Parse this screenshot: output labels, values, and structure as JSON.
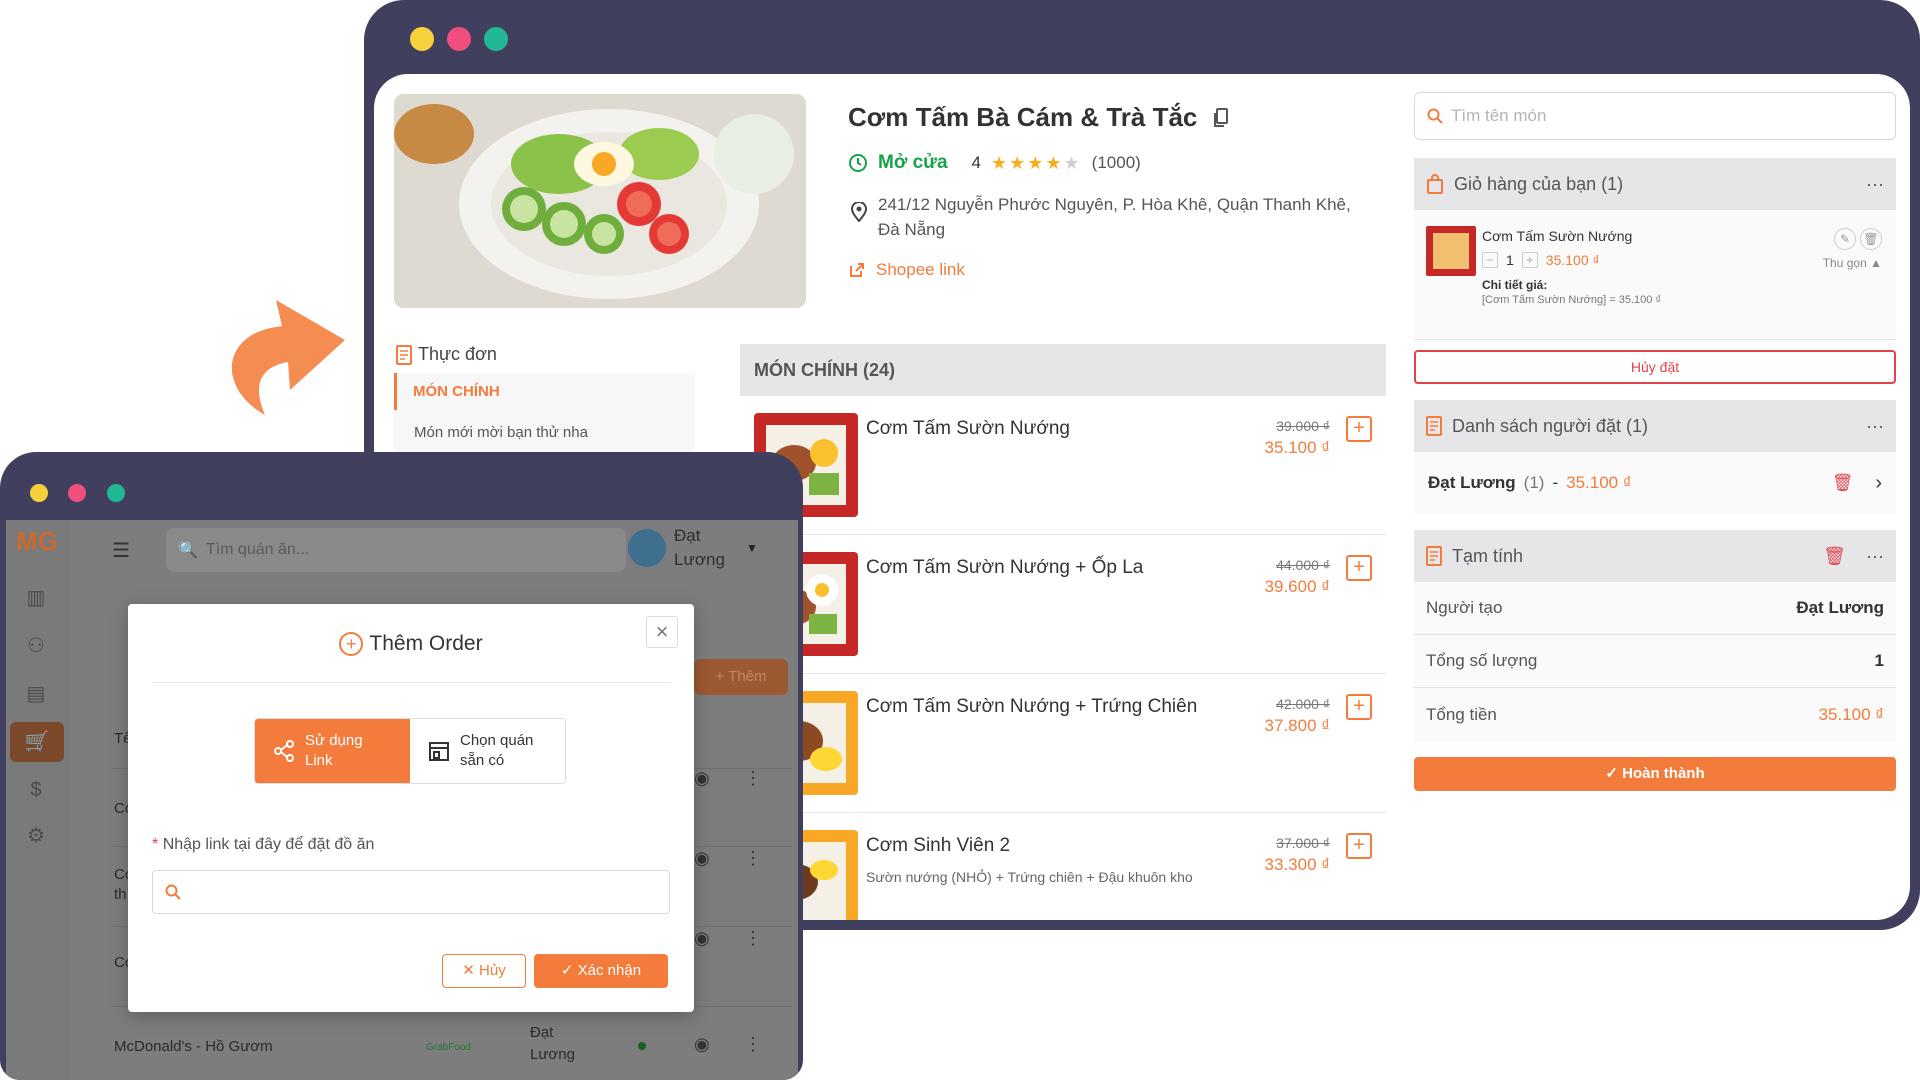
{
  "restaurant": {
    "name": "Cơm Tấm Bà Cám & Trà Tắc",
    "status": "Mở cửa",
    "rating": "4",
    "review_count": "(1000)",
    "address": "241/12 Nguyễn Phước Nguyên, P. Hòa Khê, Quận Thanh Khê, Đà Nẵng",
    "shopee_link": "Shopee link"
  },
  "menu_sidebar": {
    "header": "Thực đơn",
    "active_item": "MÓN CHÍNH",
    "sub_item": "Món mới mời bạn thử nha"
  },
  "menu_list": {
    "category": "MÓN CHÍNH (24)",
    "items": [
      {
        "name": "Cơm Tấm Sườn Nướng",
        "desc": "",
        "old_price": "39.000 ₫",
        "price": "35.100 ₫"
      },
      {
        "name": "Cơm Tấm Sườn Nướng + Ốp La",
        "desc": "",
        "old_price": "44.000 ₫",
        "price": "39.600 ₫"
      },
      {
        "name": "Cơm Tấm Sườn Nướng + Trứng Chiên",
        "desc": "",
        "old_price": "42.000 ₫",
        "price": "37.800 ₫"
      },
      {
        "name": "Cơm Sinh Viên 2",
        "desc": "Sườn nướng (NHỎ) + Trứng chiên + Đậu khuôn kho",
        "old_price": "37.000 ₫",
        "price": "33.300 ₫"
      }
    ]
  },
  "right_panel": {
    "search_placeholder": "Tìm tên món",
    "cart": {
      "title": "Giỏ hàng của bạn (1)",
      "item_name": "Cơm Tấm Sườn Nướng",
      "quantity": "1",
      "item_price": "35.100 ₫",
      "collapse": "Thu gọn",
      "price_detail_label": "Chi tiết giá:",
      "price_detail": "[Cơm Tấm Sườn Nướng] = 35.100 ₫",
      "cancel": "Hủy đặt"
    },
    "orderers": {
      "title": "Danh sách người đặt (1)",
      "name": "Đạt Lương",
      "count": "(1)",
      "dash": "-",
      "amount": "35.100 ₫"
    },
    "summary": {
      "title": "Tạm tính",
      "creator_label": "Người tạo",
      "creator_value": "Đạt Lương",
      "qty_label": "Tổng số lượng",
      "qty_value": "1",
      "total_label": "Tổng tiền",
      "total_value": "35.100 ₫",
      "done": "Hoàn thành"
    }
  },
  "app": {
    "logo": "MG",
    "search_placeholder": "Tìm quán ăn...",
    "user_name": "Đạt Lương",
    "add_button": "+ Thêm",
    "table_header_fragment": "Tê",
    "row_fragments": [
      "Co",
      "Co",
      "th",
      "Co"
    ],
    "last_row": {
      "name": "McDonald's - Hồ Gươm",
      "source": "GrabFood",
      "owner": "Đạt Lương"
    }
  },
  "modal": {
    "title": "Thêm Order",
    "option_link": "Sử dụng Link",
    "option_store": "Chọn quán sẵn có",
    "label": "Nhập link tại đây để đặt đồ ăn",
    "required_mark": "*",
    "input_value": "",
    "cancel": "Hủy",
    "confirm": "Xác nhận"
  },
  "colors": {
    "accent": "#f37c3d",
    "window_frame": "#413f5e",
    "danger": "#e2434b",
    "open": "#16a34a"
  }
}
